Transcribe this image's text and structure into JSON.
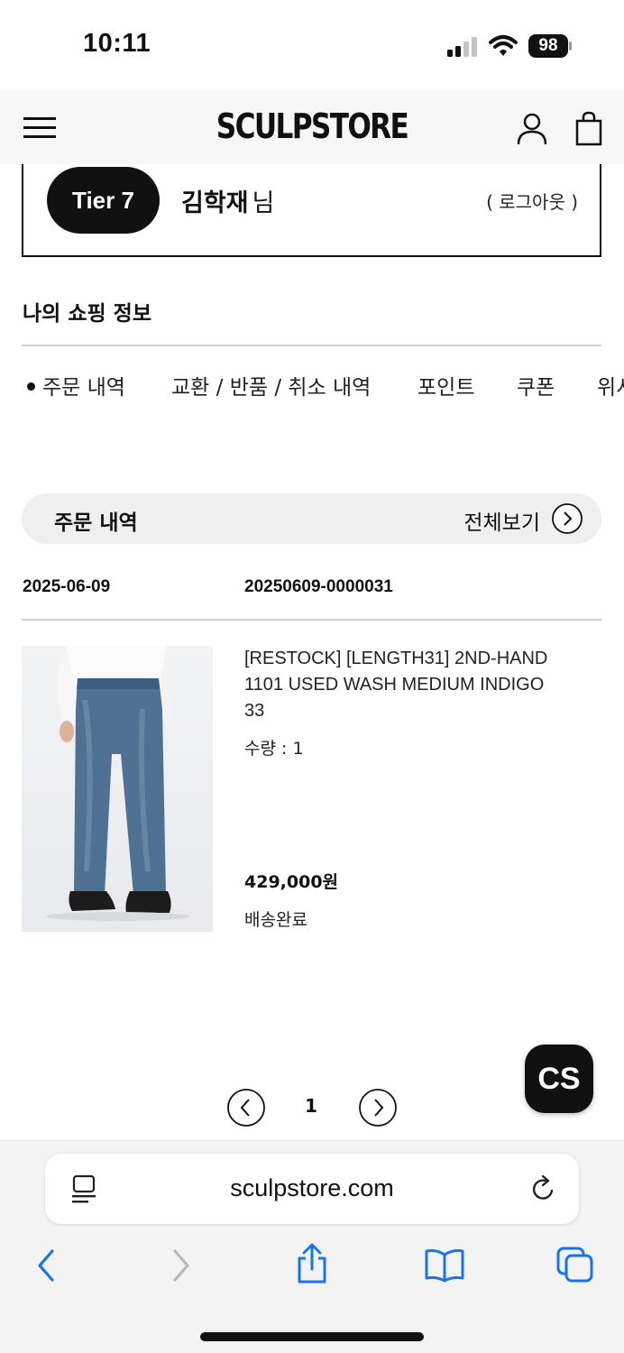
{
  "status_bar": {
    "time": "10:11",
    "battery": "98"
  },
  "header": {
    "logo": "SCULPSTORE"
  },
  "profile": {
    "tier": "Tier 7",
    "name": "김학재",
    "name_suffix": "님",
    "logout": "( 로그아웃 )"
  },
  "shopping_info": {
    "title": "나의 쇼핑 정보",
    "tabs": [
      {
        "label": "주문 내역",
        "active": true
      },
      {
        "label": "교환 / 반품 / 취소 내역",
        "active": false
      },
      {
        "label": "포인트",
        "active": false
      },
      {
        "label": "쿠폰",
        "active": false
      },
      {
        "label": "위시",
        "active": false
      }
    ]
  },
  "orders": {
    "title": "주문 내역",
    "view_all": "전체보기",
    "items": [
      {
        "date": "2025-06-09",
        "order_number": "20250609-0000031",
        "product_name": "[RESTOCK] [LENGTH31] 2ND-HAND 1101 USED WASH MEDIUM INDIGO",
        "size": "33",
        "quantity": "수량 : 1",
        "price": "429,000원",
        "status": "배송완료"
      }
    ]
  },
  "pagination": {
    "current_page": "1"
  },
  "cs_button": {
    "label": "CS"
  },
  "browser": {
    "url": "sculpstore.com"
  },
  "colors": {
    "accent_blue": "#1a73e8",
    "dark": "#111111",
    "pill_bg": "#efefef"
  }
}
